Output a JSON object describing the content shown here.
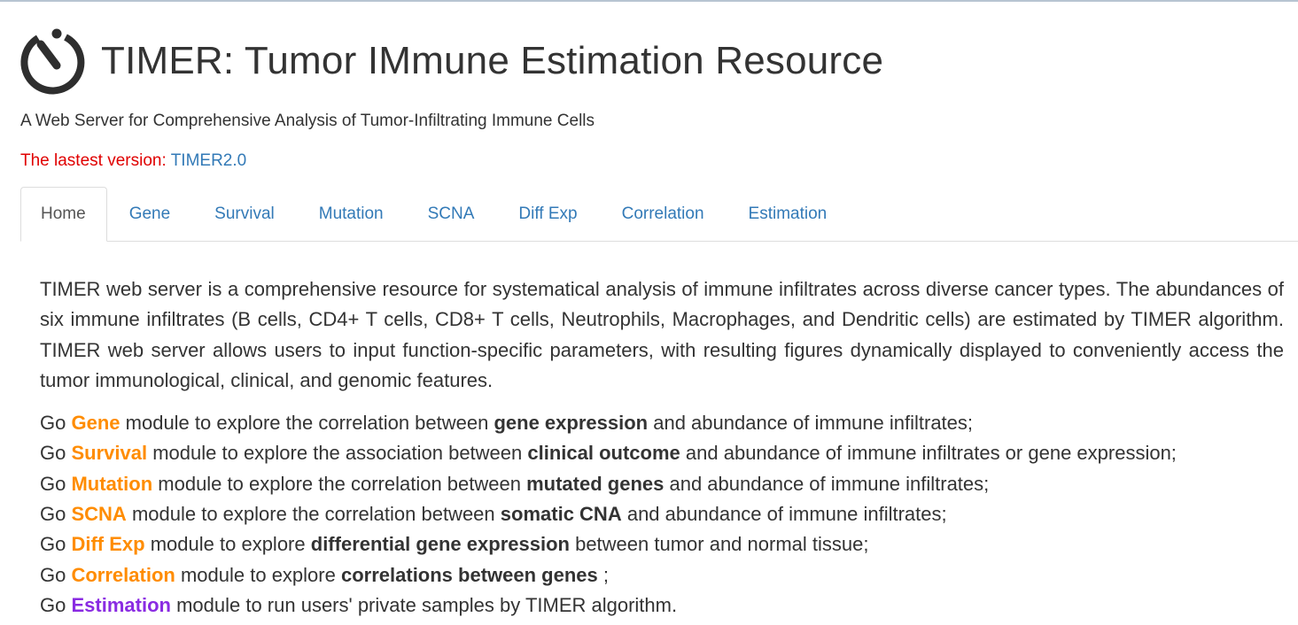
{
  "header": {
    "title": "TIMER: Tumor IMmune Estimation Resource",
    "subtitle": "A Web Server for Comprehensive Analysis of Tumor-Infiltrating Immune Cells",
    "logo_icon": "stopwatch-icon"
  },
  "version": {
    "label": "The lastest version:",
    "link_text": "TIMER2.0",
    "label_color": "#e00000",
    "link_color": "#337ab7"
  },
  "tabs": [
    {
      "label": "Home",
      "active": true
    },
    {
      "label": "Gene",
      "active": false
    },
    {
      "label": "Survival",
      "active": false
    },
    {
      "label": "Mutation",
      "active": false
    },
    {
      "label": "SCNA",
      "active": false
    },
    {
      "label": "Diff Exp",
      "active": false
    },
    {
      "label": "Correlation",
      "active": false
    },
    {
      "label": "Estimation",
      "active": false
    }
  ],
  "intro": "TIMER web server is a comprehensive resource for systematical analysis of immune infiltrates across diverse cancer types. The abundances of six immune infiltrates (B cells, CD4+ T cells, CD8+ T cells, Neutrophils, Macrophages, and Dendritic cells) are estimated by TIMER algorithm. TIMER web server allows users to input function-specific parameters, with resulting figures dynamically displayed to conveniently access the tumor immunological, clinical, and genomic features.",
  "modules": [
    {
      "go": "Go",
      "name": "Gene",
      "pre": "module to explore the correlation between",
      "bold": "gene expression",
      "post": "and abundance of immune infiltrates;"
    },
    {
      "go": "Go",
      "name": "Survival",
      "pre": "module to explore the association between",
      "bold": "clinical outcome",
      "post": "and abundance of immune infiltrates or gene expression;"
    },
    {
      "go": "Go",
      "name": "Mutation",
      "pre": "module to explore the correlation between",
      "bold": "mutated genes",
      "post": "and abundance of immune infiltrates;"
    },
    {
      "go": "Go",
      "name": "SCNA",
      "pre": "module to explore the correlation between",
      "bold": "somatic CNA",
      "post": "and abundance of immune infiltrates;"
    },
    {
      "go": "Go",
      "name": "Diff Exp",
      "pre": "module to explore",
      "bold": "differential gene expression",
      "post": "between tumor and normal tissue;"
    },
    {
      "go": "Go",
      "name": "Correlation",
      "pre": "module to explore",
      "bold": "correlations between genes",
      "post": ";"
    },
    {
      "go": "Go",
      "name": "Estimation",
      "pre": "module to run users' private samples by TIMER algorithm.",
      "bold": "",
      "post": ""
    }
  ],
  "colors": {
    "module_orange": "#ff8c00",
    "module_purple": "#8a2be2",
    "tab_link": "#337ab7"
  }
}
